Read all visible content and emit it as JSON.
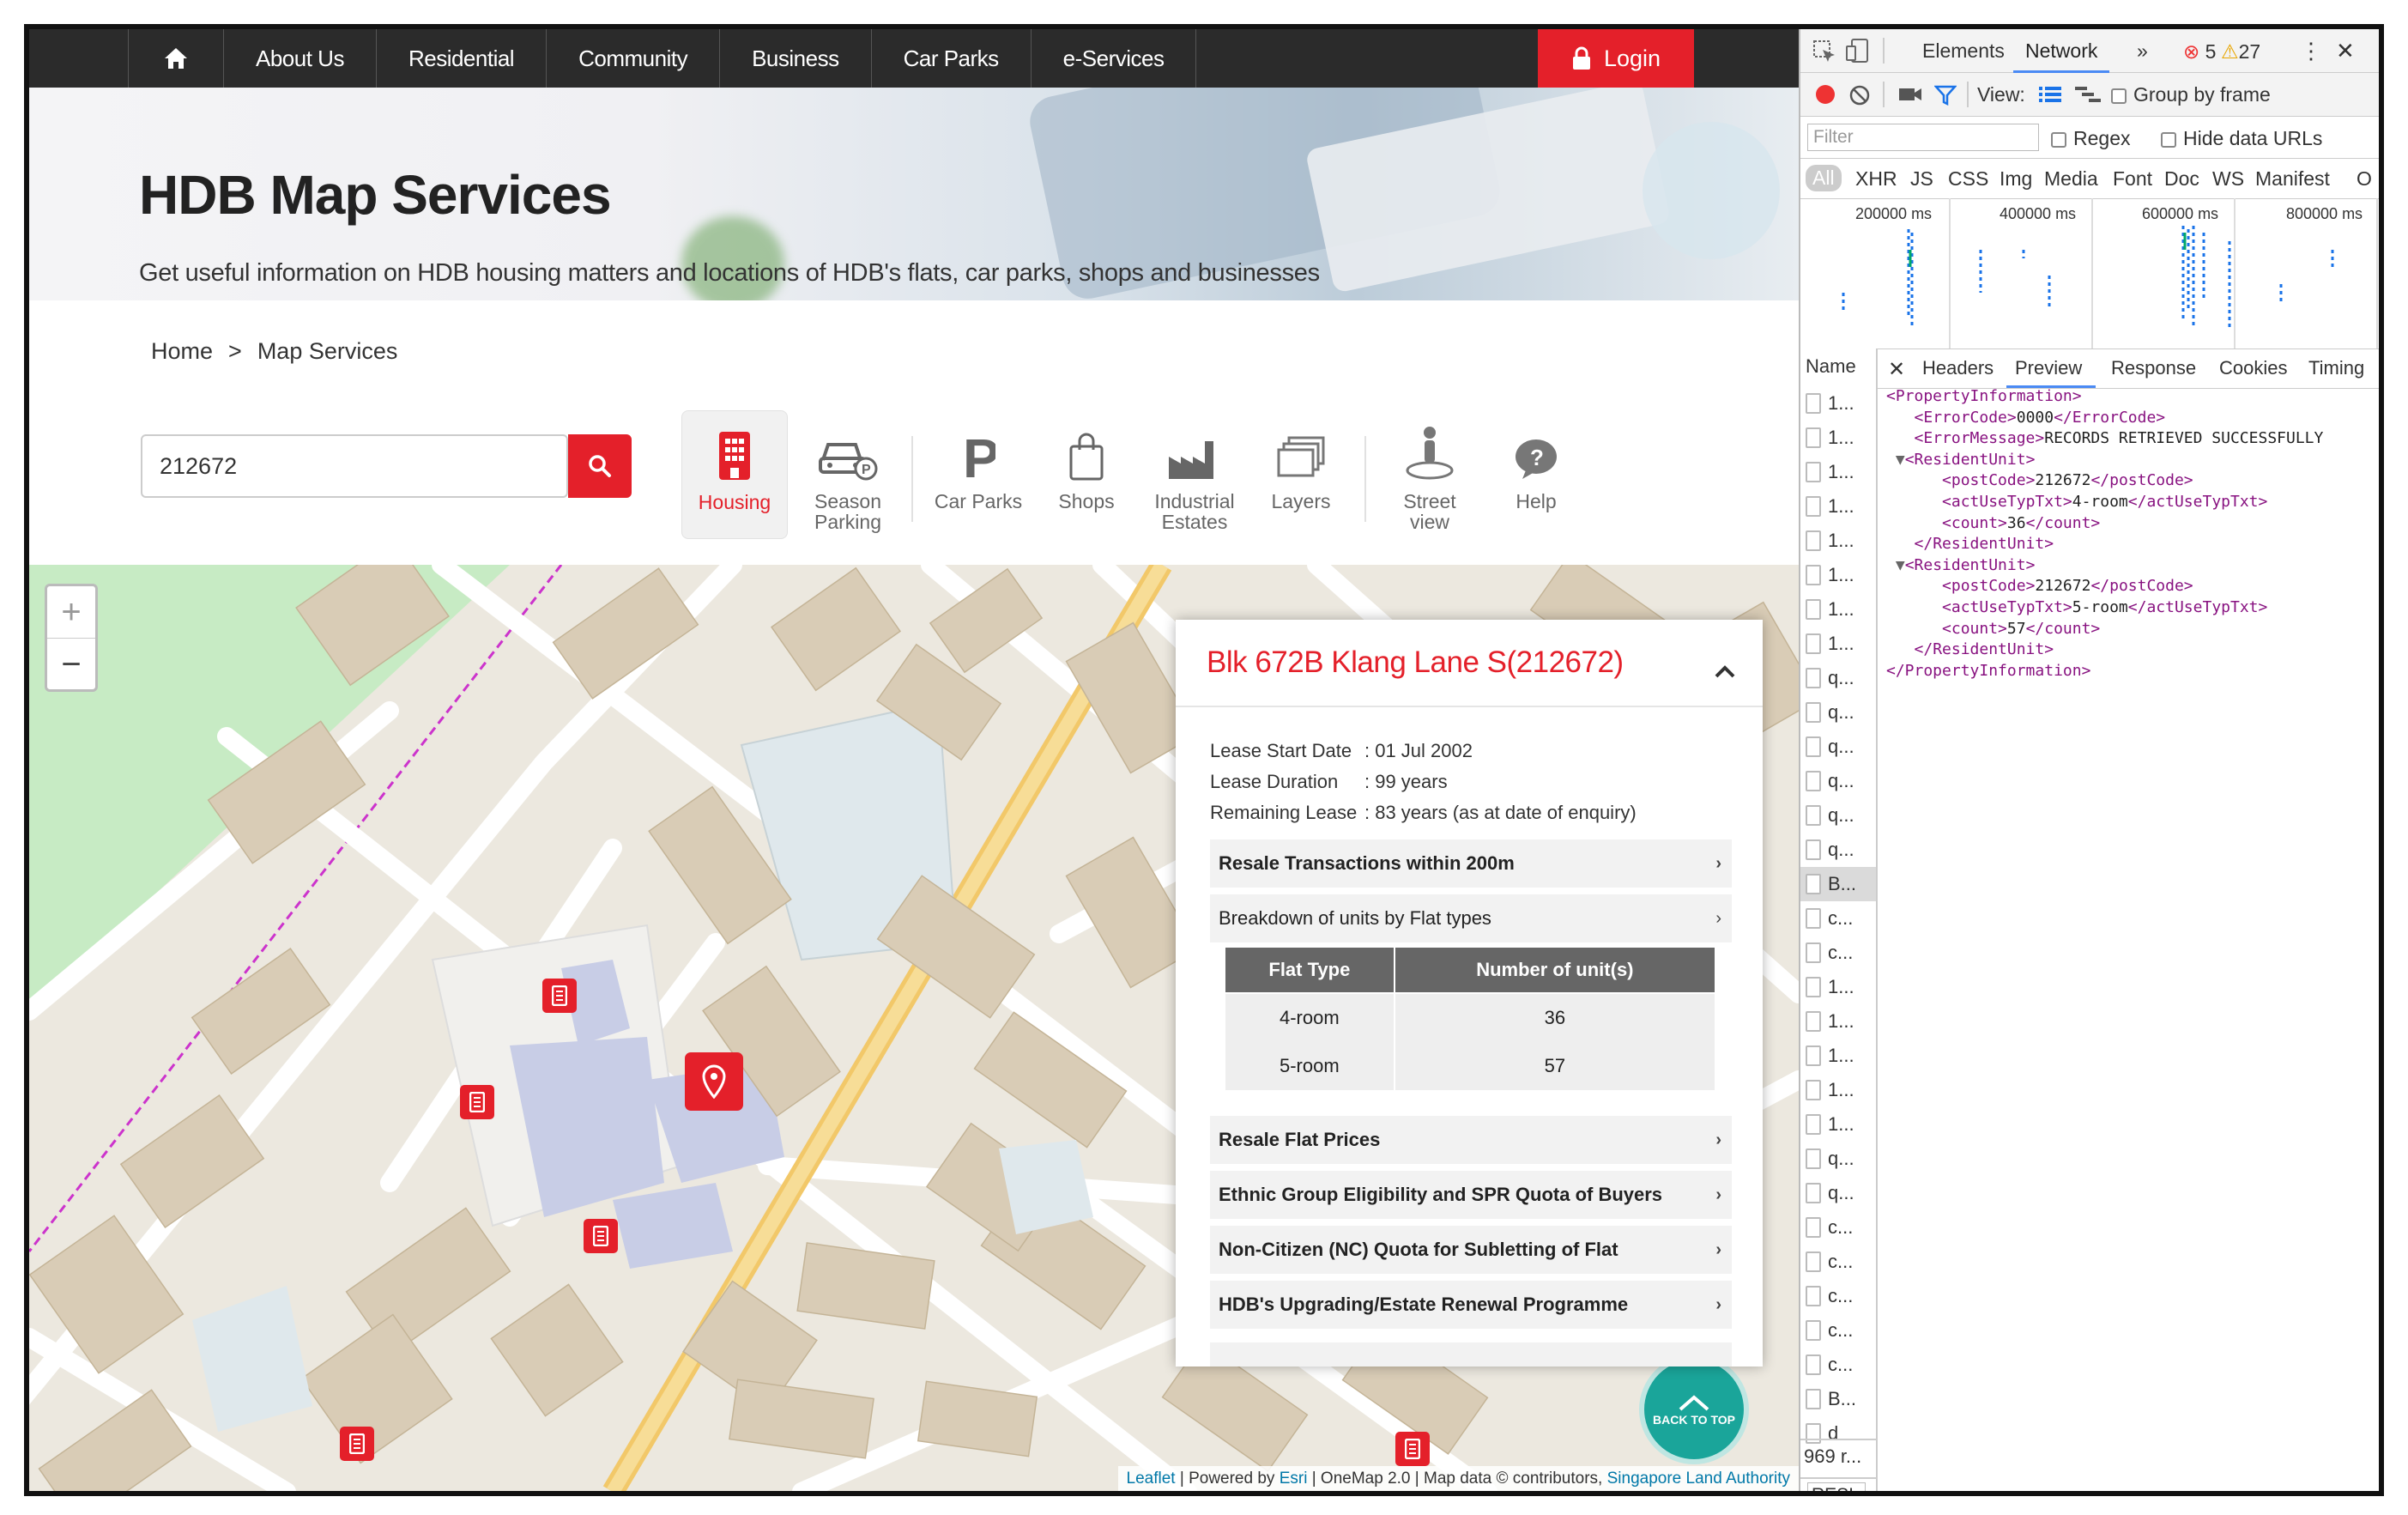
{
  "nav": {
    "items": [
      "About Us",
      "Residential",
      "Community",
      "Business",
      "Car Parks",
      "e-Services"
    ],
    "login": "Login"
  },
  "banner": {
    "title": "HDB Map Services",
    "subtitle": "Get useful information on HDB housing matters and locations of HDB's flats, car parks, shops and businesses"
  },
  "breadcrumb": {
    "home": "Home",
    "sep": ">",
    "current": "Map Services"
  },
  "search": {
    "value": "212672"
  },
  "tools": [
    {
      "label": "Housing",
      "icon": "building-icon",
      "active": true
    },
    {
      "label": "Season Parking",
      "icon": "car-parking-icon"
    },
    {
      "label": "Car Parks",
      "icon": "parking-p-icon"
    },
    {
      "label": "Shops",
      "icon": "shopping-bag-icon"
    },
    {
      "label": "Industrial Estates",
      "icon": "factory-icon"
    },
    {
      "label": "Layers",
      "icon": "layers-icon"
    },
    {
      "label": "Street view",
      "icon": "street-view-icon"
    },
    {
      "label": "Help",
      "icon": "help-bubble-icon"
    }
  ],
  "map": {
    "zoom_in": "+",
    "zoom_out": "−",
    "back_to_top": "BACK TO TOP",
    "attribution": {
      "leaflet": "Leaflet",
      "powered": "| Powered by",
      "esri": "Esri",
      "rest": "| OneMap 2.0 | Map data © contributors,",
      "sla": "Singapore Land Authority"
    }
  },
  "panel": {
    "title": "Blk 672B Klang Lane S(212672)",
    "lease": [
      {
        "label": "Lease Start Date",
        "value": ": 01 Jul 2002"
      },
      {
        "label": "Lease Duration",
        "value": ": 99 years"
      },
      {
        "label": "Remaining Lease",
        "value": ": 83 years (as at date of enquiry)"
      }
    ],
    "accordions": [
      "Resale Transactions within 200m",
      "Breakdown of units by Flat types",
      "Resale Flat Prices",
      "Ethnic Group Eligibility and SPR Quota of Buyers",
      "Non-Citizen (NC) Quota for Subletting of Flat",
      "HDB's Upgrading/Estate Renewal Programme"
    ],
    "table": {
      "headers": [
        "Flat Type",
        "Number of unit(s)"
      ],
      "rows": [
        [
          "4-room",
          "36"
        ],
        [
          "5-room",
          "57"
        ]
      ]
    },
    "chevron": "›"
  },
  "devtools": {
    "tabs": [
      "Elements",
      "Network"
    ],
    "more": "»",
    "errors": "5",
    "warnings": "27",
    "view_label": "View:",
    "group_by_frame": "Group by frame",
    "filter_placeholder": "Filter",
    "regex": "Regex",
    "hide_data_urls": "Hide data URLs",
    "types": [
      "All",
      "XHR",
      "JS",
      "CSS",
      "Img",
      "Media",
      "Font",
      "Doc",
      "WS",
      "Manifest",
      "O"
    ],
    "timeline": [
      "200000 ms",
      "400000 ms",
      "600000 ms",
      "800000 ms"
    ],
    "name_header": "Name",
    "subtabs": [
      "Headers",
      "Preview",
      "Response",
      "Cookies",
      "Timing"
    ],
    "names": [
      "1...",
      "1...",
      "1...",
      "1...",
      "1...",
      "1...",
      "1...",
      "1...",
      "q...",
      "q...",
      "q...",
      "q...",
      "q...",
      "q...",
      "B...",
      "c...",
      "c...",
      "1...",
      "1...",
      "1...",
      "1...",
      "1...",
      "q...",
      "q...",
      "c...",
      "c...",
      "c...",
      "c...",
      "c...",
      "B...",
      "d"
    ],
    "requests_count": "969 r...",
    "bottom": "RESI",
    "xml": {
      "l1": "<PropertyInformation>",
      "l2a": "<ErrorCode>",
      "l2v": "0000",
      "l2b": "</ErrorCode>",
      "l3a": "<ErrorMessage>",
      "l3v": "RECORDS RETRIEVED SUCCESSFULLY",
      "l4": "<ResidentUnit>",
      "l5a": "<postCode>",
      "l5v": "212672",
      "l5b": "</postCode>",
      "l6a": "<actUseTypTxt>",
      "l6v": "4-room",
      "l6b": "</actUseTypTxt>",
      "l7a": "<count>",
      "l7v": "36",
      "l7b": "</count>",
      "l8": "</ResidentUnit>",
      "l9": "<ResidentUnit>",
      "l10a": "<postCode>",
      "l10v": "212672",
      "l10b": "</postCode>",
      "l11a": "<actUseTypTxt>",
      "l11v": "5-room",
      "l11b": "</actUseTypTxt>",
      "l12a": "<count>",
      "l12v": "57",
      "l12b": "</count>",
      "l13": "</ResidentUnit>",
      "l14": "</PropertyInformation>"
    }
  },
  "colors": {
    "brand_red": "#e4202a",
    "nav_dark": "#2b2b2b",
    "teal": "#1aa59a"
  }
}
